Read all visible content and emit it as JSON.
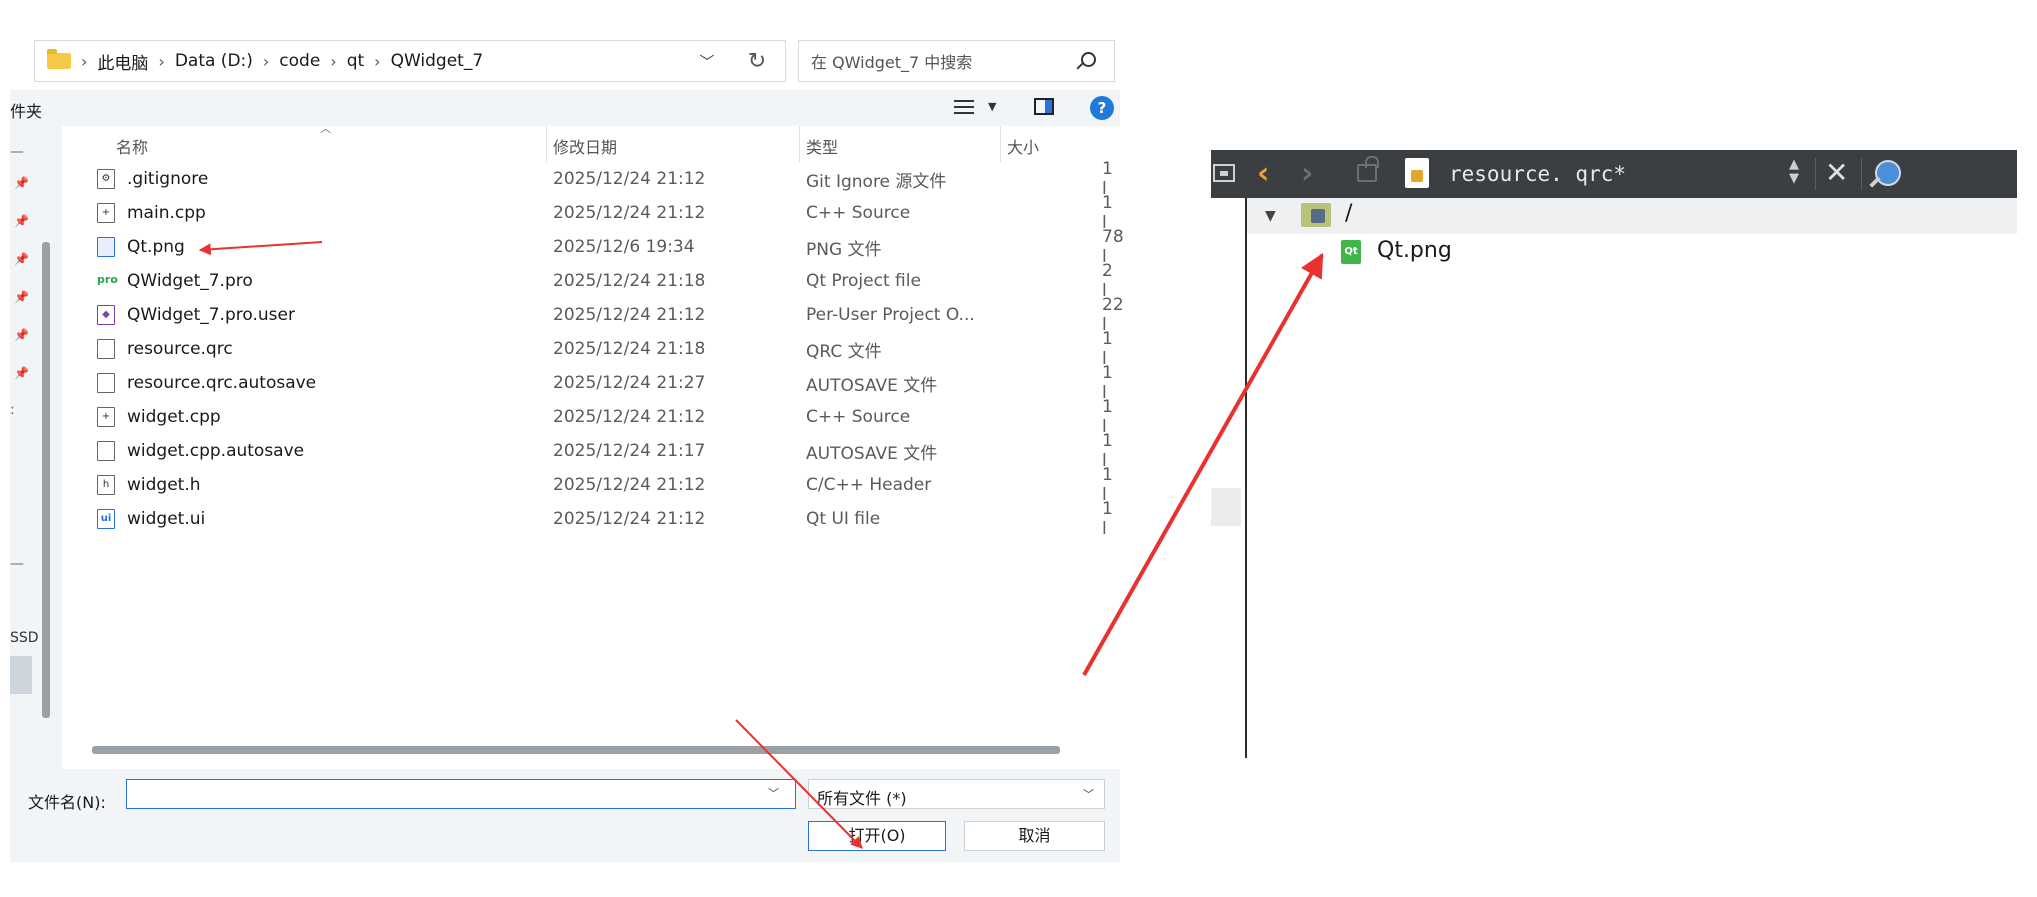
{
  "dialog": {
    "breadcrumb": [
      "此电脑",
      "Data (D:)",
      "code",
      "qt",
      "QWidget_7"
    ],
    "search_placeholder": "在 QWidget_7 中搜索",
    "command_label": "件夹",
    "nav": {
      "ssd_label": "SSD"
    },
    "columns": {
      "name": "名称",
      "date": "修改日期",
      "type": "类型",
      "size": "大小"
    },
    "files": [
      {
        "name": ".gitignore",
        "date": "2025/12/24 21:12",
        "type": "Git Ignore 源文件",
        "size": "1 l",
        "icon": "settings-file-icon"
      },
      {
        "name": "main.cpp",
        "date": "2025/12/24 21:12",
        "type": "C++ Source",
        "size": "1 l",
        "icon": "cpp-file-icon"
      },
      {
        "name": "Qt.png",
        "date": "2025/12/6 19:34",
        "type": "PNG 文件",
        "size": "78 l",
        "icon": "image-file-icon"
      },
      {
        "name": "QWidget_7.pro",
        "date": "2025/12/24 21:18",
        "type": "Qt Project file",
        "size": "2 l",
        "icon": "pro-file-icon"
      },
      {
        "name": "QWidget_7.pro.user",
        "date": "2025/12/24 21:12",
        "type": "Per-User Project O...",
        "size": "22 l",
        "icon": "user-file-icon"
      },
      {
        "name": "resource.qrc",
        "date": "2025/12/24 21:18",
        "type": "QRC 文件",
        "size": "1 l",
        "icon": "file-icon"
      },
      {
        "name": "resource.qrc.autosave",
        "date": "2025/12/24 21:27",
        "type": "AUTOSAVE 文件",
        "size": "1 l",
        "icon": "file-icon"
      },
      {
        "name": "widget.cpp",
        "date": "2025/12/24 21:12",
        "type": "C++ Source",
        "size": "1 l",
        "icon": "cpp-file-icon"
      },
      {
        "name": "widget.cpp.autosave",
        "date": "2025/12/24 21:17",
        "type": "AUTOSAVE 文件",
        "size": "1 l",
        "icon": "file-icon"
      },
      {
        "name": "widget.h",
        "date": "2025/12/24 21:12",
        "type": "C/C++ Header",
        "size": "1 l",
        "icon": "header-file-icon"
      },
      {
        "name": "widget.ui",
        "date": "2025/12/24 21:12",
        "type": "Qt UI file",
        "size": "1 l",
        "icon": "ui-file-icon"
      }
    ],
    "filename_label": "文件名(N):",
    "filename_value": "",
    "filter_value": "所有文件 (*)",
    "open_label": "打开(O)",
    "cancel_label": "取消"
  },
  "qt_editor": {
    "filename": "resource. qrc*",
    "prefix": "/",
    "resource_file": "Qt.png",
    "png_icon_text": "Qt"
  },
  "colors": {
    "accent": "#2a72d8",
    "annotation_arrow": "#e8322f",
    "qt_toolbar": "#3c3f41",
    "qt_back_arrow": "#e8a33a"
  }
}
